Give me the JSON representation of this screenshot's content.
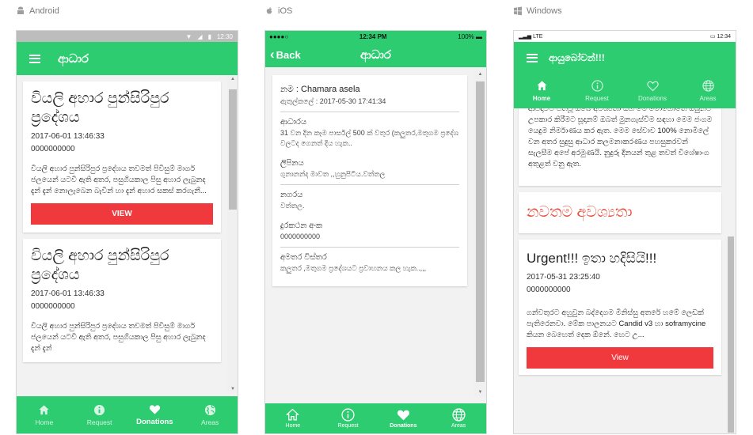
{
  "labels": {
    "android": "Android",
    "ios": "iOS",
    "windows": "Windows"
  },
  "colors": {
    "primary": "#2ecc71",
    "danger": "#f0393d",
    "section_title": "#e74c3c"
  },
  "android": {
    "status_time": "12:30",
    "title": "ආධාර",
    "cards": [
      {
        "title": "වියලි අහාර පුන්සිරිපුර ප්‍රදේශය",
        "date": "2017-06-01 13:46:33",
        "phone": "0000000000",
        "text": "වියලි අහාර පුන්සිරිපුර ප්‍රදේශය තවමත් පිවිසුම් මාර්ග ජලයෙන් යටවී ඇති අතර, පසුගියකාල පිසු අහාර ලැබුනද දැන් දැන් නොලැබෙන බැවින් හා දැන් අහාර සකස් කරගැනී...",
        "button": "VIEW"
      },
      {
        "title": "වියලි අහාර පුන්සිරිපුර ප්‍රදේශය",
        "date": "2017-06-01 13:46:33",
        "phone": "0000000000",
        "text": "වියලි අහාර පුන්සිරිපුර ප්‍රදේශය තවමත් පිවිසුම් මාර්ග ජලයෙන් යටවී ඇති අතර, පසුගියකාල පිසු අහාර ලැබුනද දැන් දැන්",
        "button": "VIEW"
      }
    ],
    "nav": [
      {
        "label": "Home",
        "icon": "home-icon"
      },
      {
        "label": "Request",
        "icon": "info-icon"
      },
      {
        "label": "Donations",
        "icon": "heart-icon"
      },
      {
        "label": "Areas",
        "icon": "globe-icon"
      }
    ]
  },
  "ios": {
    "carrier": "●●●●○",
    "status_time": "12:34 PM",
    "battery": "100%",
    "back": "Back",
    "title": "ආධාර",
    "header_name": "නම : Chamara asela",
    "header_date": "ඇතුල්කලේ : 2017-05-30 17:41:34",
    "details": [
      {
        "label": "ආධාරය",
        "value": "31 වන දින කෑම පාර්සල් 500 ක් වතුර (කලුතර,මතුගම ප්‍රදේශ වලටද ගෙනත් දිය හැක.."
      },
      {
        "label": "ලිපිනය",
        "value": "ගුනානන්ද මාවත ,,හුනුපිටිය.වත්තල"
      },
      {
        "label": "නගරය",
        "value": "වත්තල."
      },
      {
        "label": "දුරකථන අංක",
        "value": "0000000000"
      },
      {
        "label": "අමතර විස්තර",
        "value": "කලුතර ,මතුගම ප්‍රදේශයට ප්‍රවාහනය කල හැක..,,,"
      }
    ],
    "nav": [
      {
        "label": "Home",
        "icon": "home-icon"
      },
      {
        "label": "Request",
        "icon": "info-icon"
      },
      {
        "label": "Donations",
        "icon": "heart-icon"
      },
      {
        "label": "Areas",
        "icon": "globe-icon"
      }
    ]
  },
  "windows": {
    "network": "LTE",
    "status_time": "12:34",
    "title": "ආයුබෝවන්!!!",
    "tabs": [
      {
        "label": "Home",
        "icon": "home-icon"
      },
      {
        "label": "Request",
        "icon": "info-icon"
      },
      {
        "label": "Donations",
        "icon": "heart-icon"
      },
      {
        "label": "Areas",
        "icon": "globe-icon"
      }
    ],
    "top_text": "ආපදාවට පත්වූ ඔබේ අවශ්‍යතා සහ මේ මොහොතේ ඔබුන්ට උපකාර කිරීමට සූදානම් ඔබත් මුනගැස්වීම සඳහා මෙම ජංගම යෙදුම නිර්මාණය කර ඇත. මෙම සේවාව 100% නොමිලේ වන අතර සුදුසු ආධාර කලමනාකරණය පහසුකරවන් සැලසීම අපේ අරමුණයි. නුදුරු දිනයන් තුළ තවත් විශේෂාංග අතුළත් වනු ඇත.",
    "section_title": "නවතම අවශ්‍යතා",
    "urgent": {
      "title": "Urgent!!! ඉතා හදිසියි!!!",
      "date": "2017-05-31 23:25:40",
      "phone": "0000000000",
      "text": "ගන්වතුරට අහුවුන බද්දෙගම මිනිස්සු අතරේ හමේ ලෙඩක් පැතිරෙනවා. මේක පාලනයට Candid v3 හා soframycine කියන බෙහෙත් දෙක ඕනේ. හෙට උ...",
      "button": "View"
    }
  }
}
